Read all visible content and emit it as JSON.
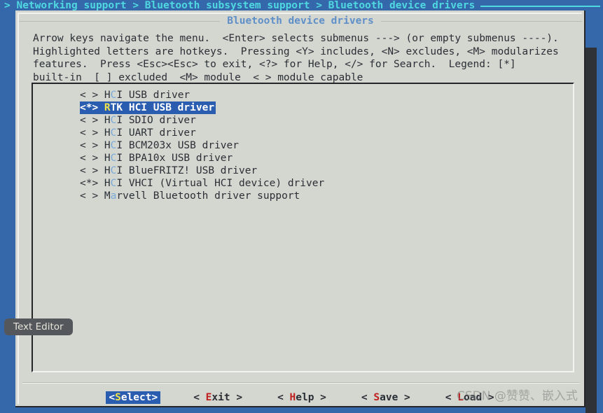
{
  "breadcrumb": {
    "text": "> Networking support > Bluetooth subsystem support > Bluetooth device drivers"
  },
  "dialog": {
    "title": "Bluetooth device drivers",
    "help_text": "Arrow keys navigate the menu.  <Enter> selects submenus ---> (or empty submenus ----).\nHighlighted letters are hotkeys.  Pressing <Y> includes, <N> excludes, <M> modularizes\nfeatures.  Press <Esc><Esc> to exit, <?> for Help, </> for Search.  Legend: [*]\nbuilt-in  [ ] excluded  <M> module  < > module capable"
  },
  "menu": {
    "items": [
      {
        "state": "< > ",
        "pre": "H",
        "hotkey": "C",
        "post": "I USB driver",
        "selected": false
      },
      {
        "state": "<*> ",
        "pre": "",
        "hotkey": "R",
        "post": "TK HCI USB driver",
        "selected": true
      },
      {
        "state": "< > ",
        "pre": "H",
        "hotkey": "C",
        "post": "I SDIO driver",
        "selected": false
      },
      {
        "state": "< > ",
        "pre": "H",
        "hotkey": "C",
        "post": "I UART driver",
        "selected": false
      },
      {
        "state": "< > ",
        "pre": "H",
        "hotkey": "C",
        "post": "I BCM203x USB driver",
        "selected": false
      },
      {
        "state": "< > ",
        "pre": "H",
        "hotkey": "C",
        "post": "I BPA10x USB driver",
        "selected": false
      },
      {
        "state": "< > ",
        "pre": "H",
        "hotkey": "C",
        "post": "I BlueFRITZ! USB driver",
        "selected": false
      },
      {
        "state": "<*> ",
        "pre": "H",
        "hotkey": "C",
        "post": "I VHCI (Virtual HCI device) driver",
        "selected": false
      },
      {
        "state": "< > ",
        "pre": "M",
        "hotkey": "a",
        "post": "rvell Bluetooth driver support",
        "selected": false
      }
    ]
  },
  "buttons": [
    {
      "pre": "<",
      "hotkey": "S",
      "post": "elect>",
      "active": true,
      "name": "select"
    },
    {
      "pre": "< ",
      "hotkey": "E",
      "post": "xit >",
      "active": false,
      "name": "exit"
    },
    {
      "pre": "< ",
      "hotkey": "H",
      "post": "elp >",
      "active": false,
      "name": "help"
    },
    {
      "pre": "< ",
      "hotkey": "S",
      "post": "ave >",
      "active": false,
      "name": "save"
    },
    {
      "pre": "< ",
      "hotkey": "L",
      "post": "oad >",
      "active": false,
      "name": "load"
    }
  ],
  "tooltip": {
    "label": "Text Editor"
  },
  "watermark": {
    "text": "CSDN @赞赞、嵌入式"
  },
  "colors": {
    "desktop_blue": "#3568ab",
    "breadcrumb_cyan": "#4fd8e0",
    "dialog_bg": "#d4d7d0",
    "title_blue": "#5f8fc9",
    "highlight_blue": "#2a5db0",
    "hotkey_blue": "#77a8d8",
    "hotkey_yellow": "#f2e34a",
    "button_hotkey_red": "#c02020"
  }
}
